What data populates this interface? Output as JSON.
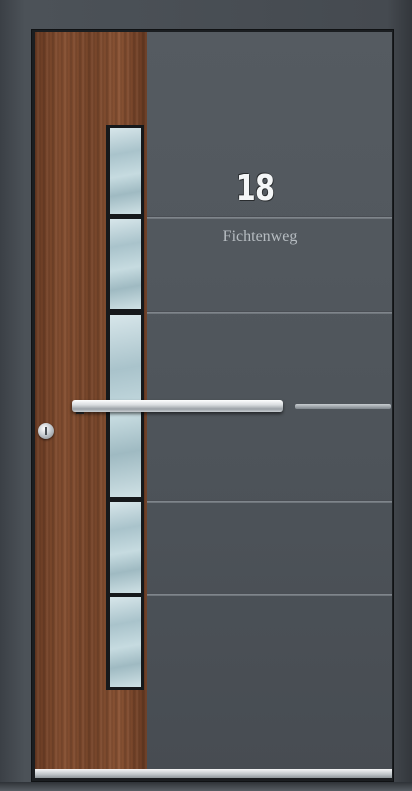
{
  "house_number": "18",
  "street_name": "Fichtenweg",
  "colors": {
    "panel": "#52585e",
    "wood": "#7f4a2d",
    "glass": "#b9d1d7",
    "steel": "#d9dde0",
    "frame": "#464b51"
  }
}
